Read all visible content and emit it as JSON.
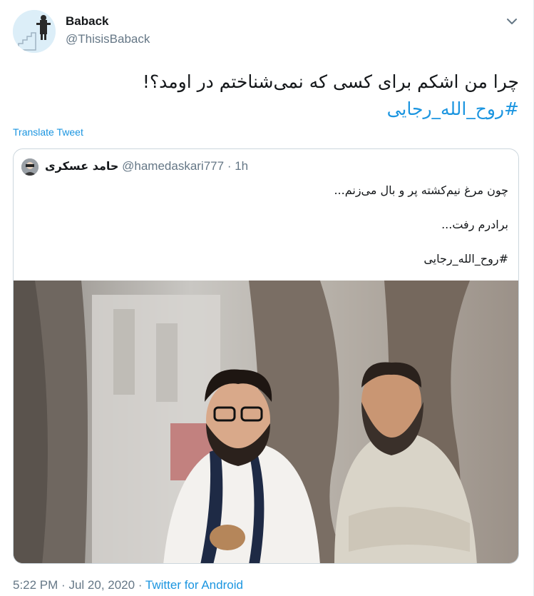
{
  "tweet": {
    "display_name": "Baback",
    "handle": "@ThisisBaback",
    "text": "چرا من اشکم برای کسی که نمی‌شناختم در اومد؟!",
    "hashtag": "#روح_الله_رجایی",
    "translate_label": "Translate Tweet",
    "menu_icon": "chevron-down-icon"
  },
  "quoted": {
    "name": "حامد عسکری",
    "handle": "@hamedaskari777",
    "separator": "·",
    "time": "1h",
    "line1": "چون مرغ نیم‌کشته پر و بال می‌زنم...",
    "line2": "برادرم رفت...",
    "hashtag": "#روح_الله_رجایی"
  },
  "footer": {
    "time": "5:22 PM",
    "sep1": "·",
    "date": "Jul 20, 2020",
    "sep2": "·",
    "source": "Twitter for Android"
  },
  "colors": {
    "accent": "#1b95e0",
    "secondary_text": "#657786",
    "border": "#ccd6dd"
  }
}
